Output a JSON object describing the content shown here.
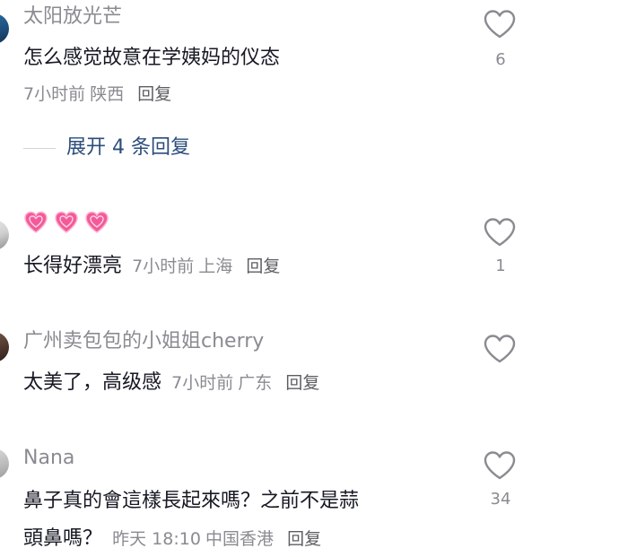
{
  "comments": [
    {
      "username": "太阳放光芒",
      "text": "怎么感觉故意在学姨妈的仪态",
      "time": "7小时前",
      "location": "陕西",
      "reply_label": "回复",
      "likes": "6",
      "expand_replies": "展开 4 条回复",
      "avatar_color": "#1d4c78"
    },
    {
      "username_emoji": [
        "pink-heart-emoji",
        "pink-heart-emoji",
        "pink-heart-emoji"
      ],
      "text": "长得好漂亮",
      "time": "7小时前",
      "location": "上海",
      "reply_label": "回复",
      "likes": "1"
    },
    {
      "username": "广州卖包包的小姐姐cherry",
      "text": "太美了，高级感",
      "time": "7小时前",
      "location": "广东",
      "reply_label": "回复",
      "likes": ""
    },
    {
      "username": "Nana",
      "text_line1": "鼻子真的會這樣長起來嗎？之前不是蒜",
      "text_line2": "頭鼻嗎？",
      "time": "昨天 18:10",
      "location": "中国香港",
      "reply_label": "回复",
      "likes": "34"
    }
  ],
  "colors": {
    "username": "#8a8b91",
    "text": "#161823",
    "expand": "#2b4d7b",
    "heart_outline": "#8a8b91",
    "emoji_heart": "#f25a9a"
  }
}
